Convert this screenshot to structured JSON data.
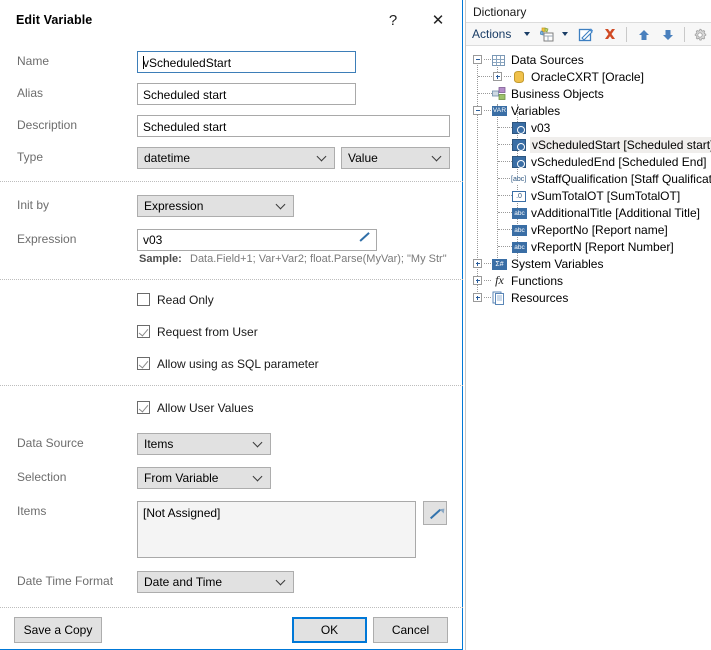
{
  "dialog": {
    "title": "Edit Variable",
    "help_label": "?",
    "close_label": "✕",
    "fields": {
      "name_label": "Name",
      "name_value": "vScheduledStart",
      "alias_label": "Alias",
      "alias_value": "Scheduled start",
      "description_label": "Description",
      "description_value": "Scheduled start",
      "type_label": "Type",
      "type_value": "datetime",
      "type_kind_value": "Value",
      "init_by_label": "Init by",
      "init_by_value": "Expression",
      "expression_label": "Expression",
      "expression_value": "v03",
      "sample_label": "Sample:",
      "sample_text": "Data.Field+1; Var+Var2; float.Parse(MyVar); \"My Str\"",
      "data_source_label": "Data Source",
      "data_source_value": "Items",
      "selection_label": "Selection",
      "selection_value": "From Variable",
      "items_label": "Items",
      "items_value": "[Not Assigned]",
      "date_time_format_label": "Date Time Format",
      "date_time_format_value": "Date and Time"
    },
    "checkboxes": [
      {
        "label": "Read Only",
        "checked": false
      },
      {
        "label": "Request from User",
        "checked": true
      },
      {
        "label": "Allow using as SQL parameter",
        "checked": true
      },
      {
        "label": "Allow User Values",
        "checked": true
      }
    ],
    "buttons": {
      "save_copy": "Save a Copy",
      "ok": "OK",
      "cancel": "Cancel"
    }
  },
  "dictionary": {
    "title": "Dictionary",
    "toolbar": {
      "actions_label": "Actions",
      "icons": [
        "new-item-icon",
        "edit-icon",
        "delete-icon",
        "move-up-icon",
        "move-down-icon",
        "settings-icon"
      ]
    },
    "tree": [
      {
        "label": "Data Sources",
        "indent": 0,
        "expander": "minus",
        "icon": "datasources-icon",
        "selected": false
      },
      {
        "label": "OracleCXRT [Oracle]",
        "indent": 1,
        "expander": "plus",
        "icon": "database-icon",
        "selected": false
      },
      {
        "label": "Business Objects",
        "indent": 0,
        "expander": "none",
        "icon": "business-objects-icon",
        "selected": false
      },
      {
        "label": "Variables",
        "indent": 0,
        "expander": "minus",
        "icon": "variables-icon",
        "selected": false
      },
      {
        "label": "v03",
        "indent": 2,
        "expander": "none",
        "icon": "datetime-var-icon",
        "selected": false
      },
      {
        "label": "vScheduledStart [Scheduled start]",
        "indent": 2,
        "expander": "none",
        "icon": "datetime-var-icon",
        "selected": true
      },
      {
        "label": "vScheduledEnd [Scheduled End]",
        "indent": 2,
        "expander": "none",
        "icon": "datetime-var-icon",
        "selected": false
      },
      {
        "label": "vStaffQualification [Staff Qualification]",
        "indent": 2,
        "expander": "none",
        "icon": "string-var-outline-icon",
        "selected": false
      },
      {
        "label": "vSumTotalOT [SumTotalOT]",
        "indent": 2,
        "expander": "none",
        "icon": "number-var-icon",
        "selected": false
      },
      {
        "label": "vAdditionalTitle [Additional Title]",
        "indent": 2,
        "expander": "none",
        "icon": "string-var-icon",
        "selected": false
      },
      {
        "label": "vReportNo [Report name]",
        "indent": 2,
        "expander": "none",
        "icon": "string-var-icon",
        "selected": false
      },
      {
        "label": "vReportN [Report Number]",
        "indent": 2,
        "expander": "none",
        "icon": "string-var-icon",
        "selected": false
      },
      {
        "label": "System Variables",
        "indent": 0,
        "expander": "plus",
        "icon": "system-variables-icon",
        "selected": false
      },
      {
        "label": "Functions",
        "indent": 0,
        "expander": "plus",
        "icon": "functions-icon",
        "selected": false
      },
      {
        "label": "Resources",
        "indent": 0,
        "expander": "plus",
        "icon": "resources-icon",
        "selected": false
      }
    ],
    "icon_glyphs": {
      "variables-icon": "VAR",
      "string-var-icon": "abc",
      "string-var-outline-icon": "[abc]",
      "number-var-icon": ".0",
      "system-variables-icon": "Σ#",
      "functions-icon": "fx"
    }
  },
  "colors": {
    "accent": "#0078d7",
    "combo_bg": "#e1e1e1",
    "label_gray": "#6d6d6d",
    "tree_icon_blue": "#3a6ea5",
    "db_yellow": "#f0c14b"
  }
}
